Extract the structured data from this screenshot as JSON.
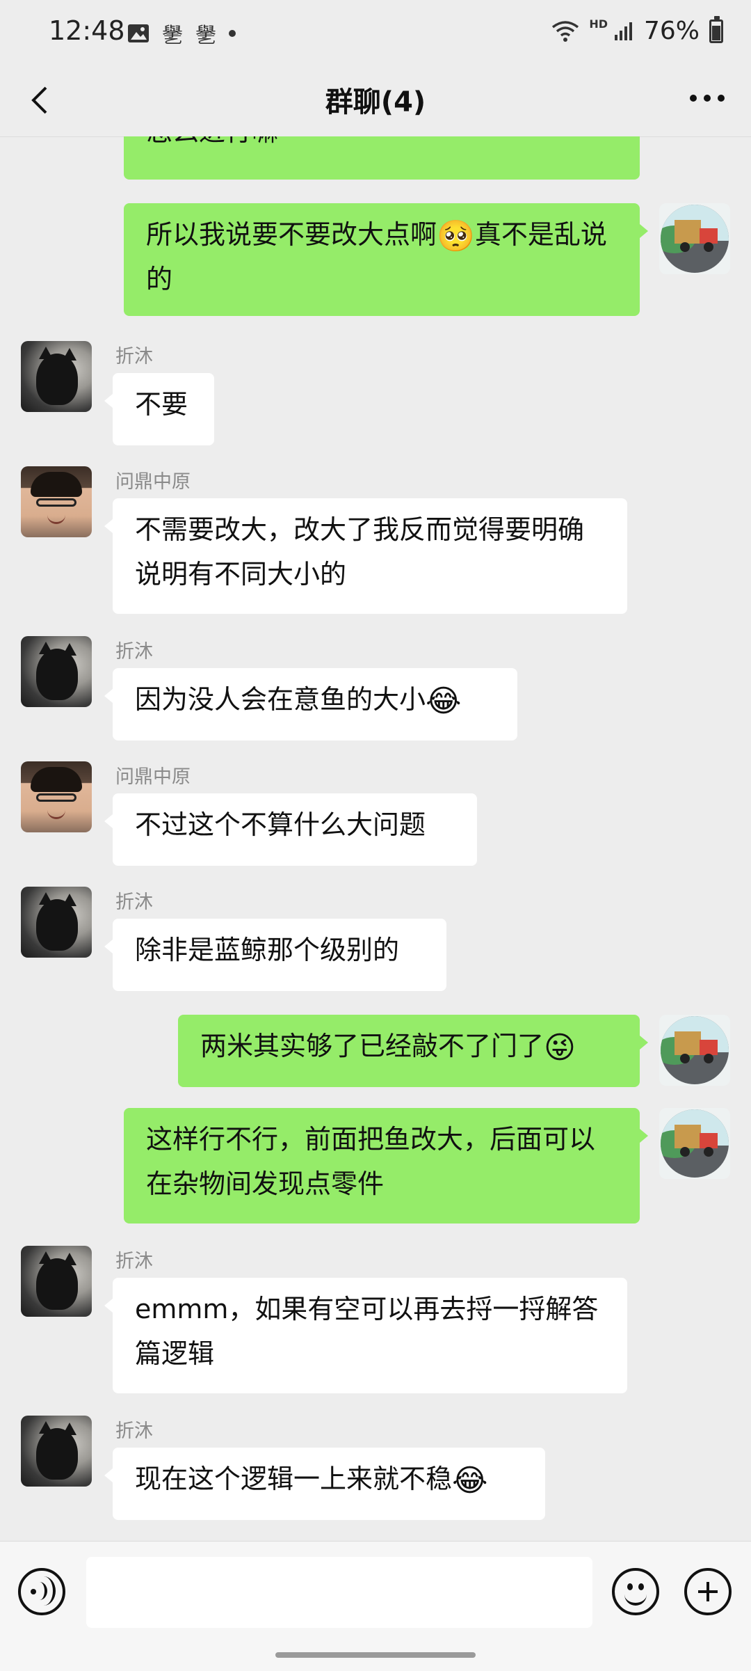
{
  "status_bar": {
    "time": "12:48",
    "left_icons": [
      "image-icon",
      "notification-icon",
      "notification-icon",
      "dot-icon"
    ],
    "notif_glyph": "㐦",
    "hd": "HD",
    "battery": "76%"
  },
  "header": {
    "title": "群聊(4)"
  },
  "messages": [
    {
      "side": "out",
      "text": "怎么进行嘛"
    },
    {
      "side": "out",
      "text": "所以我说要不要改大点啊",
      "emoji": "🥺",
      "text_after": "真不是乱说的"
    },
    {
      "side": "in",
      "sender": "折沐",
      "text": "不要"
    },
    {
      "side": "in",
      "sender": "问鼎中原",
      "text": "不需要改大，改大了我反而觉得要明确说明有不同大小的"
    },
    {
      "side": "in",
      "sender": "折沐",
      "text": "因为没人会在意鱼的大小",
      "emoji": "😂"
    },
    {
      "side": "in",
      "sender": "问鼎中原",
      "text": "不过这个不算什么大问题"
    },
    {
      "side": "in",
      "sender": "折沐",
      "text": "除非是蓝鲸那个级别的"
    },
    {
      "side": "out",
      "text": "两米其实够了已经敲不了门了",
      "emoji": "😜"
    },
    {
      "side": "out",
      "text": "这样行不行，前面把鱼改大，后面可以在杂物间发现点零件"
    },
    {
      "side": "in",
      "sender": "折沐",
      "text": "emmm，如果有空可以再去捋一捋解答篇逻辑"
    },
    {
      "side": "in",
      "sender": "折沐",
      "text": "现在这个逻辑一上来就不稳",
      "emoji": "😂"
    }
  ],
  "input_bar": {
    "placeholder": "",
    "icons": [
      "voice-icon",
      "emoji-icon",
      "plus-icon"
    ]
  },
  "colors": {
    "background": "#ededed",
    "outgoing_bubble": "#95ec69",
    "incoming_bubble": "#ffffff",
    "sender_name": "#8a8a8a"
  }
}
